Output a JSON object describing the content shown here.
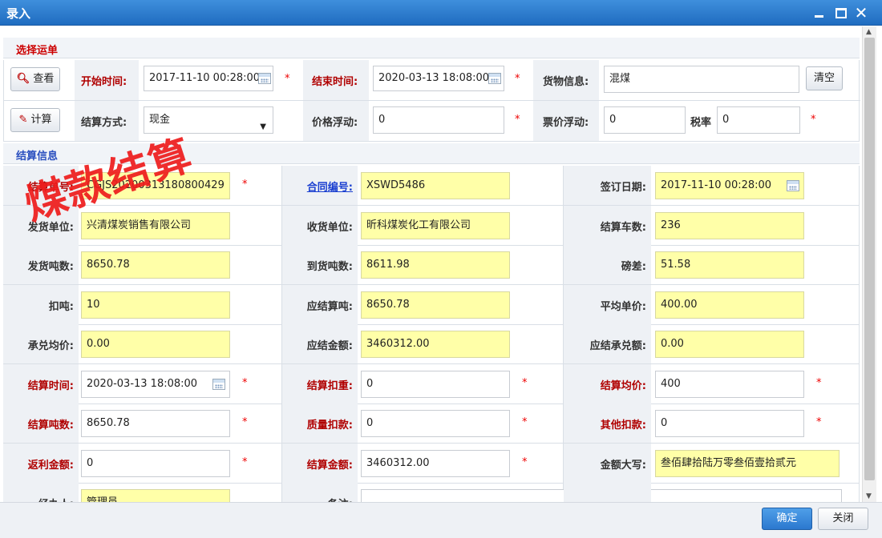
{
  "window": {
    "title": "录入"
  },
  "select_waybill": {
    "header": "选择运单",
    "view_button": "查看",
    "calc_button": "计算",
    "clear_button": "清空",
    "start_time_label": "开始时间:",
    "start_time": "2017-11-10 00:28:00",
    "end_time_label": "结束时间:",
    "end_time": "2020-03-13 18:08:00",
    "cargo_label": "货物信息:",
    "cargo": "混煤",
    "settle_method_label": "结算方式:",
    "settle_method": "现金",
    "price_float_label": "价格浮动:",
    "price_float": "0",
    "ticket_float_label": "票价浮动:",
    "ticket_float": "0",
    "tax_label": "税率",
    "tax": "0",
    "required_mark": "*"
  },
  "settle_info": {
    "header": "结算信息",
    "stamp": "煤款结算",
    "rows": [
      [
        {
          "label": "结算单号:",
          "value": "CGJS20200313180800429",
          "req": true
        },
        {
          "label": "合同编号:",
          "value": "XSWD5486"
        },
        {
          "label": "签订日期:",
          "value": "2017-11-10 00:28:00"
        }
      ],
      [
        {
          "label": "发货单位:",
          "value": "兴清煤炭销售有限公司"
        },
        {
          "label": "收货单位:",
          "value": "昕科煤炭化工有限公司"
        },
        {
          "label": "结算车数:",
          "value": "236"
        }
      ],
      [
        {
          "label": "发货吨数:",
          "value": "8650.78"
        },
        {
          "label": "到货吨数:",
          "value": "8611.98"
        },
        {
          "label": "磅差:",
          "value": "51.58"
        }
      ],
      [
        {
          "label": "扣吨:",
          "value": "10"
        },
        {
          "label": "应结算吨:",
          "value": "8650.78"
        },
        {
          "label": "平均单价:",
          "value": "400.00"
        }
      ],
      [
        {
          "label": "承兑均价:",
          "value": "0.00"
        },
        {
          "label": "应结金额:",
          "value": "3460312.00"
        },
        {
          "label": "应结承兑额:",
          "value": "0.00"
        }
      ],
      [
        {
          "label": "结算时间:",
          "value": "2020-03-13 18:08:00",
          "req": true
        },
        {
          "label": "结算扣重:",
          "value": "0",
          "req": true
        },
        {
          "label": "结算均价:",
          "value": "400",
          "req": true
        }
      ],
      [
        {
          "label": "结算吨数:",
          "value": "8650.78",
          "req": true
        },
        {
          "label": "质量扣款:",
          "value": "0",
          "req": true
        },
        {
          "label": "其他扣款:",
          "value": "0",
          "req": true
        }
      ],
      [
        {
          "label": "返利金额:",
          "value": "0",
          "req": true
        },
        {
          "label": "结算金额:",
          "value": "3460312.00",
          "req": true
        },
        {
          "label": "金额大写:",
          "value": "叁佰肆拾陆万零叁佰壹拾贰元"
        }
      ],
      [
        {
          "label": "经办人:",
          "value": "管理员"
        },
        {
          "label": "备注:",
          "value": ""
        },
        {
          "label": "",
          "value": ""
        }
      ]
    ]
  },
  "footer": {
    "ok": "确定",
    "close": "关闭"
  }
}
